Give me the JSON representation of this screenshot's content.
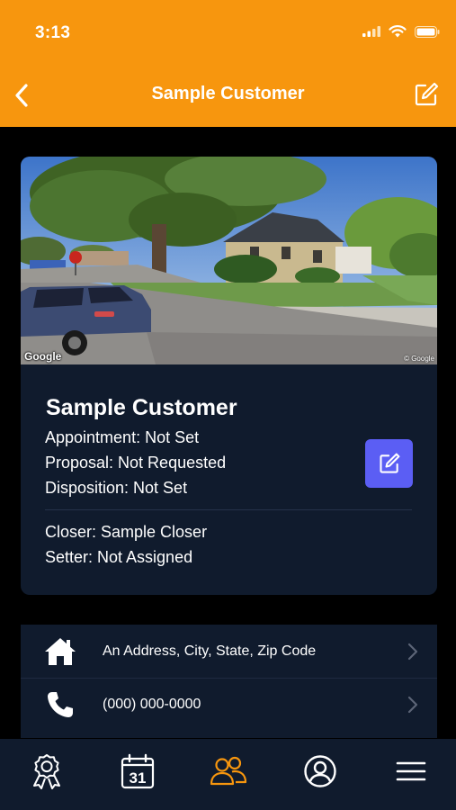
{
  "status_bar": {
    "time": "3:13"
  },
  "nav": {
    "title": "Sample Customer",
    "back_icon": "chevron-left-icon",
    "edit_icon": "edit-square-icon"
  },
  "photo": {
    "watermark_left": "Google",
    "watermark_right": "© Google"
  },
  "customer": {
    "name": "Sample Customer",
    "appointment": "Appointment: Not Set",
    "proposal": "Proposal: Not Requested",
    "disposition": "Disposition: Not Set",
    "closer": "Closer: Sample Closer",
    "setter": "Setter: Not Assigned"
  },
  "contact_rows": [
    {
      "icon": "home-icon",
      "text": "An Address, City, State, Zip Code"
    },
    {
      "icon": "phone-icon",
      "text": "(000) 000-0000"
    }
  ],
  "tabs": [
    {
      "icon": "award-ribbon-icon",
      "active": false
    },
    {
      "icon": "calendar-icon",
      "label": "31",
      "active": false
    },
    {
      "icon": "people-icon",
      "active": true
    },
    {
      "icon": "user-circle-icon",
      "active": false
    },
    {
      "icon": "menu-icon",
      "active": false
    }
  ],
  "colors": {
    "accent": "#F7960E",
    "card_bg": "#101B2D",
    "button": "#5B5EF4",
    "background": "#000000"
  }
}
